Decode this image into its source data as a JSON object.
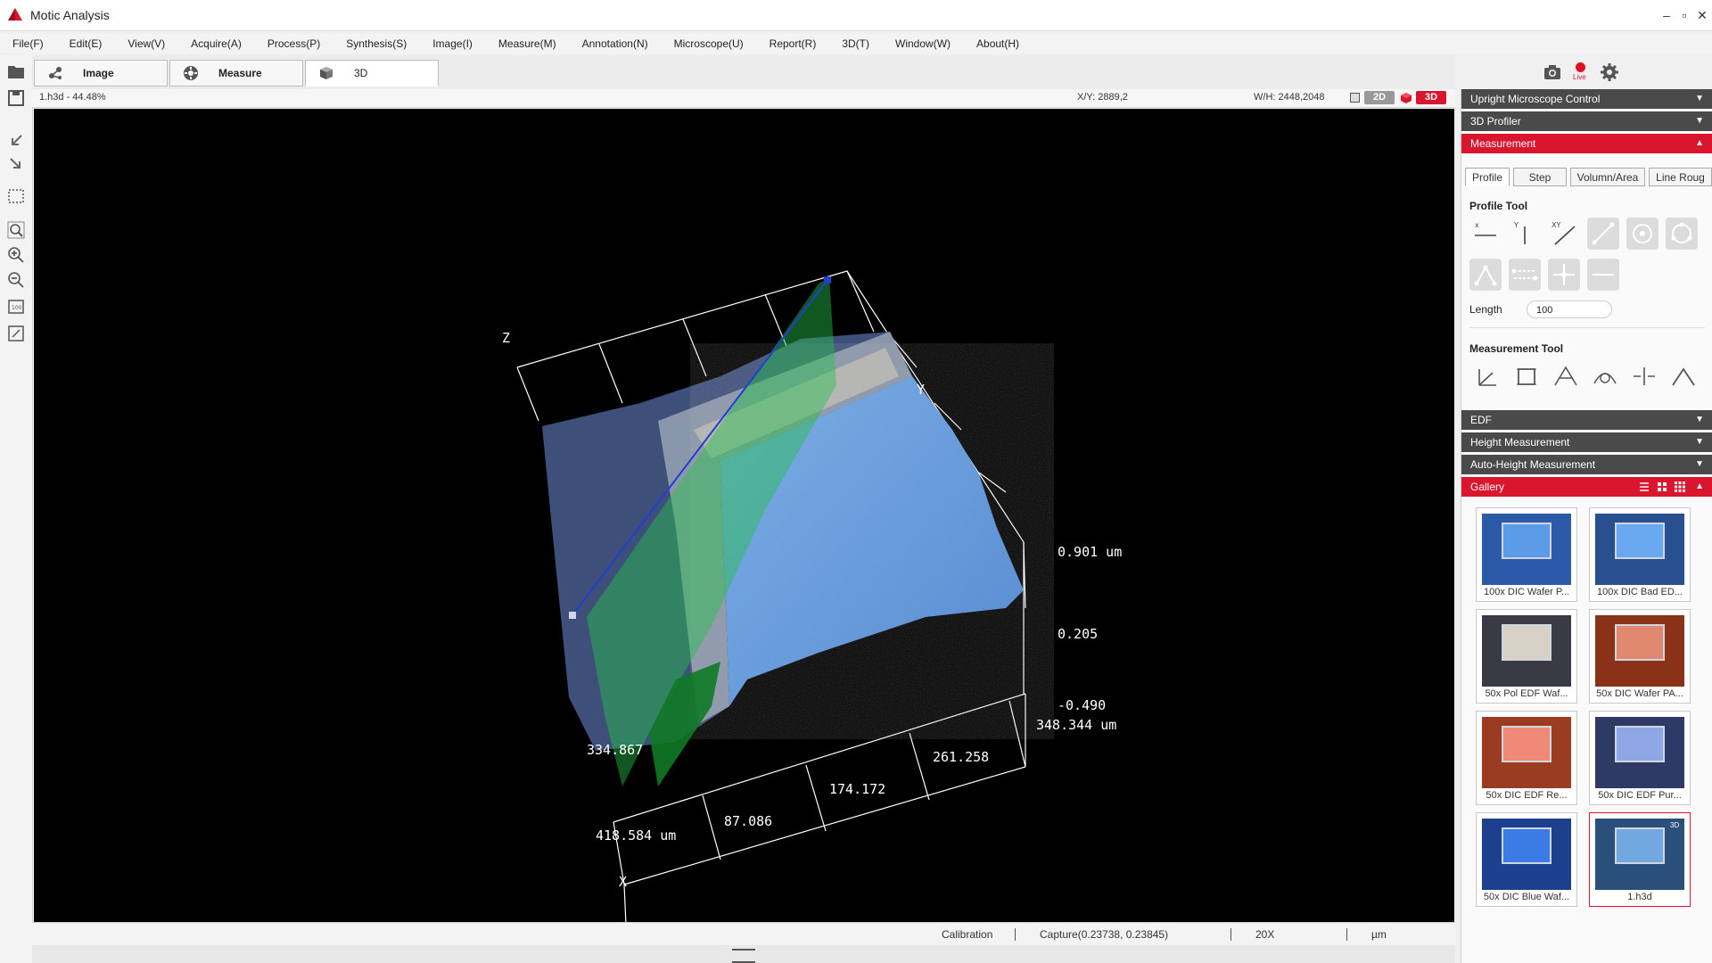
{
  "window": {
    "title": "Motic Analysis"
  },
  "menu": [
    "File(F)",
    "Edit(E)",
    "View(V)",
    "Acquire(A)",
    "Process(P)",
    "Synthesis(S)",
    "Image(I)",
    "Measure(M)",
    "Annotation(N)",
    "Microscope(U)",
    "Report(R)",
    "3D(T)",
    "Window(W)",
    "About(H)"
  ],
  "tabs": [
    {
      "label": "Image",
      "icon": "molecule-icon"
    },
    {
      "label": "Measure",
      "icon": "gear-circle-icon"
    },
    {
      "label": "3D",
      "icon": "cube-icon"
    }
  ],
  "top_icons": {
    "camera": "camera-icon",
    "live": "Live",
    "settings": "gear-icon"
  },
  "viewer": {
    "file_zoom": "1.h3d - 44.48%",
    "xy": "X/Y: 2889,2",
    "wh": "W/H: 2448,2048",
    "mode_2d": "2D",
    "mode_3d": "3D"
  },
  "plot3d": {
    "axis_labels": {
      "x": "X",
      "y": "Y",
      "z": "Z"
    },
    "z_ticks": [
      "0.901 um",
      "0.205",
      "-0.490"
    ],
    "y_ticks": [
      "348.344 um",
      "261.258",
      "174.172",
      "87.086",
      "334.867"
    ],
    "x_ticks": [
      "418.584 um"
    ]
  },
  "status": {
    "calibration": "Calibration",
    "capture": "Capture(0.23738, 0.23845)",
    "objective": "20X",
    "unit": "µm"
  },
  "panel": {
    "sections_top": [
      "Upright Microscope Control",
      "3D Profiler"
    ],
    "measurement": "Measurement",
    "subtabs": [
      "Profile",
      "Step",
      "Volumn/Area",
      "Line Roug"
    ],
    "profile_tool": "Profile Tool",
    "length_label": "Length",
    "length_value": "100",
    "measurement_tool": "Measurement Tool",
    "sections_bottom": [
      "EDF",
      "Height Measurement",
      "Auto-Height Measurement"
    ],
    "gallery": "Gallery"
  },
  "gallery": [
    {
      "caption": "100x DIC Wafer P...",
      "color": "#2c5aa8",
      "inner": "#5b9be8"
    },
    {
      "caption": "100x DIC Bad ED...",
      "color": "#2a4f90",
      "inner": "#6aa8ef"
    },
    {
      "caption": "50x Pol EDF Waf...",
      "color": "#3a3a44",
      "inner": "#d8d2c6"
    },
    {
      "caption": "50x DIC Wafer PA...",
      "color": "#8a3218",
      "inner": "#e08870"
    },
    {
      "caption": "50x DIC EDF Re...",
      "color": "#9a3c22",
      "inner": "#ef8a78"
    },
    {
      "caption": "50x DIC EDF Pur...",
      "color": "#2e3a66",
      "inner": "#8ea8e6"
    },
    {
      "caption": "50x DIC Blue Waf...",
      "color": "#1c3f8e",
      "inner": "#3b7be6"
    },
    {
      "caption": "1.h3d",
      "color": "#2a4f7a",
      "inner": "#72a8e0",
      "badge": "3D",
      "selected": true
    }
  ],
  "colors": {
    "accent": "#d9162e",
    "section_bg": "#4a4a4a"
  }
}
